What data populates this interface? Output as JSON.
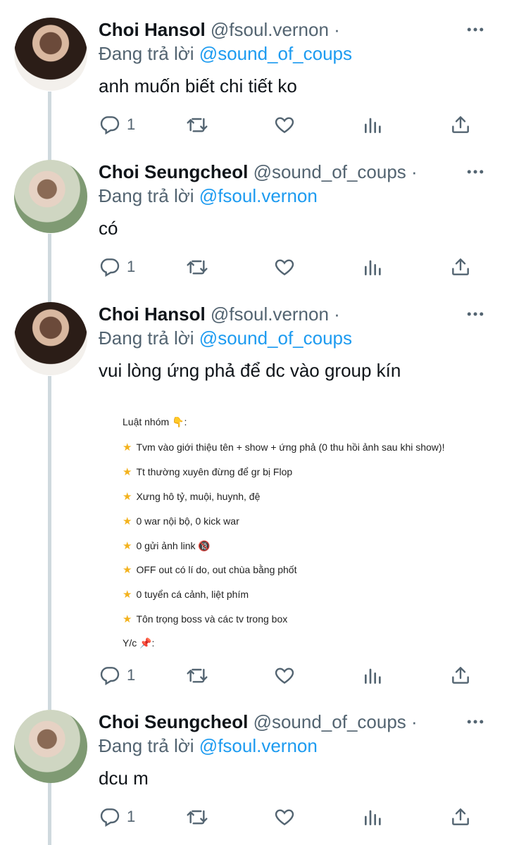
{
  "tweets": [
    {
      "name": "Choi Hansol",
      "handle": "@fsoul.vernon ·",
      "reply_prefix": "Đang trả lời",
      "reply_to": "@sound_of_coups",
      "text": "anh muốn biết chi tiết ko",
      "reply_count": "1"
    },
    {
      "name": "Choi Seungcheol",
      "handle": "@sound_of_coups ·",
      "reply_prefix": "Đang trả lời",
      "reply_to": "@fsoul.vernon",
      "text": "có",
      "reply_count": "1"
    },
    {
      "name": "Choi Hansol",
      "handle": "@fsoul.vernon ·",
      "reply_prefix": "Đang trả lời",
      "reply_to": "@sound_of_coups",
      "text": "vui lòng ứng phả để dc vào group kín",
      "reply_count": "1",
      "image": {
        "title": "Luật nhóm 👇:",
        "rules": [
          "Tvm vào giới thiệu tên + show + ứng phả (0 thu hồi ảnh sau khi show)!",
          "Tt thường xuyên đừng để gr bị Flop",
          "Xưng hô tỷ, muội, huynh, đệ",
          "0 war nội bộ, 0 kick war",
          "0 gửi ảnh link 🔞",
          "OFF out có lí do, out chùa bằng phốt",
          "0 tuyển cá cảnh, liệt phím",
          "Tôn trọng boss và các tv trong box"
        ],
        "footer": "Y/c 📌:"
      }
    },
    {
      "name": "Choi Seungcheol",
      "handle": "@sound_of_coups ·",
      "reply_prefix": "Đang trả lời",
      "reply_to": "@fsoul.vernon",
      "text": "dcu m",
      "reply_count": "1"
    }
  ],
  "icons": {
    "reply": "reply-icon",
    "retweet": "retweet-icon",
    "like": "heart-icon",
    "views": "views-icon",
    "share": "share-icon",
    "more": "more-icon"
  },
  "colors": {
    "link": "#1d9bf0",
    "secondary": "#536471",
    "thread_line": "#cfd9de"
  }
}
